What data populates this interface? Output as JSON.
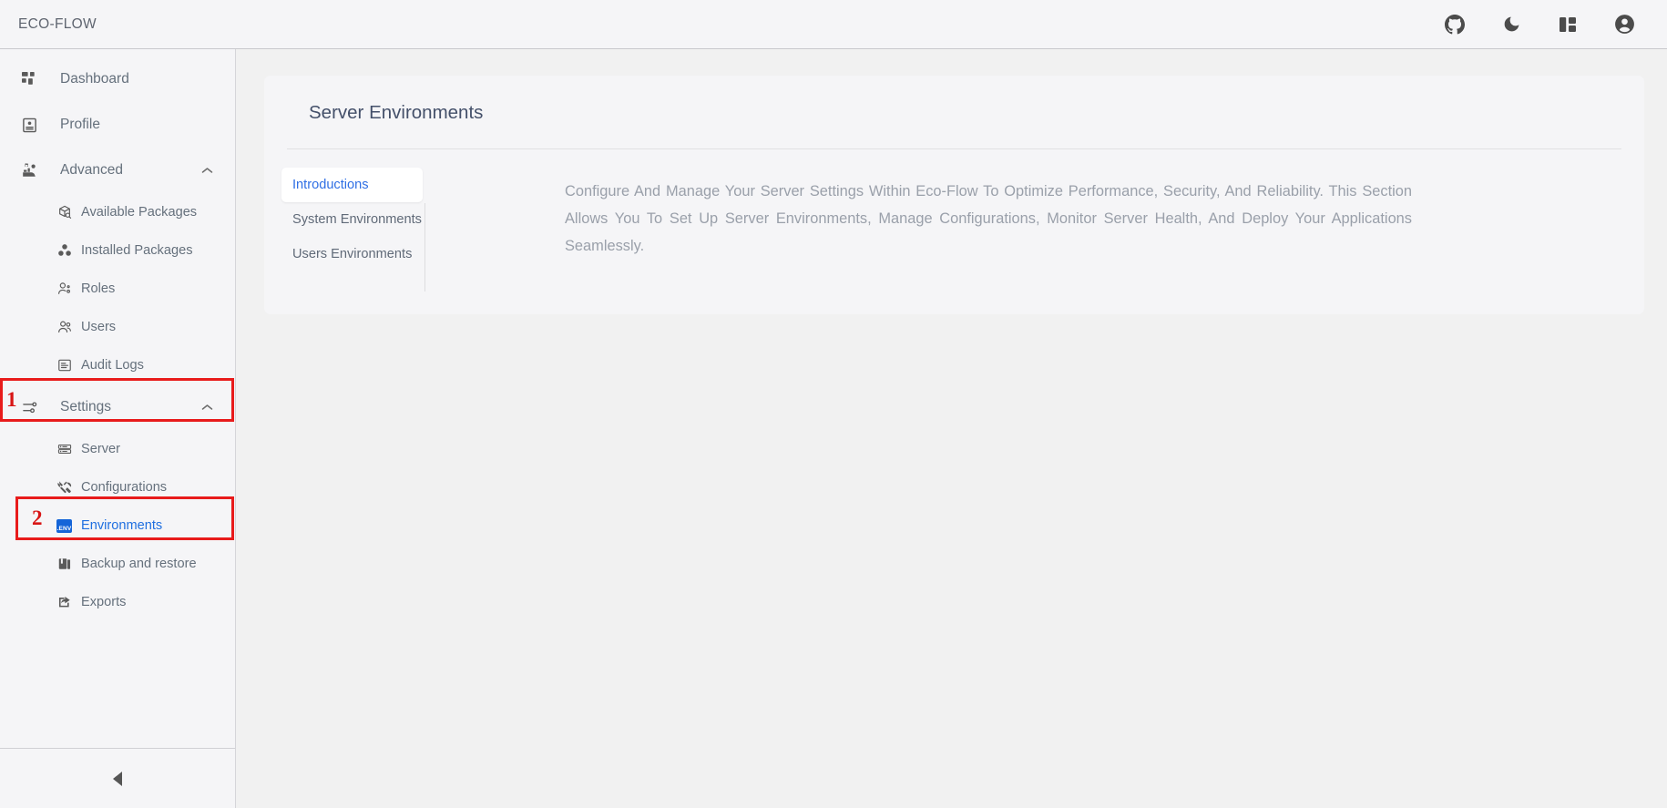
{
  "topbar": {
    "brand": "ECO-FLOW",
    "actions": [
      {
        "name": "github-icon",
        "label": "GitHub"
      },
      {
        "name": "moon-icon",
        "label": "Toggle dark mode"
      },
      {
        "name": "layout-icon",
        "label": "Layout"
      },
      {
        "name": "account-icon",
        "label": "Account"
      }
    ]
  },
  "sidebar": {
    "items": [
      {
        "label": "Dashboard",
        "icon": "dashboard-icon",
        "type": "top"
      },
      {
        "label": "Profile",
        "icon": "profile-icon",
        "type": "top"
      },
      {
        "label": "Advanced",
        "icon": "advanced-icon",
        "type": "group",
        "expanded": true
      },
      {
        "label": "Available Packages",
        "icon": "package-search-icon",
        "type": "sub"
      },
      {
        "label": "Installed Packages",
        "icon": "packages-icon",
        "type": "sub"
      },
      {
        "label": "Roles",
        "icon": "roles-icon",
        "type": "sub"
      },
      {
        "label": "Users",
        "icon": "users-icon",
        "type": "sub"
      },
      {
        "label": "Audit Logs",
        "icon": "audit-logs-icon",
        "type": "sub"
      },
      {
        "label": "Settings",
        "icon": "settings-sliders-icon",
        "type": "group",
        "expanded": true
      },
      {
        "label": "Server",
        "icon": "server-icon",
        "type": "sub"
      },
      {
        "label": "Configurations",
        "icon": "configurations-icon",
        "type": "sub"
      },
      {
        "label": "Environments",
        "icon": "env-badge-icon",
        "type": "sub",
        "active": true
      },
      {
        "label": "Backup and restore",
        "icon": "backup-icon",
        "type": "sub"
      },
      {
        "label": "Exports",
        "icon": "exports-icon",
        "type": "sub"
      }
    ],
    "collapse": {
      "icon": "collapse-left-icon"
    }
  },
  "annotations": [
    {
      "number": "1",
      "target": "Settings"
    },
    {
      "number": "2",
      "target": "Environments"
    }
  ],
  "main": {
    "card": {
      "title": "Server Environments",
      "tabs": [
        {
          "label": "Introductions",
          "active": true
        },
        {
          "label": "System Environments",
          "active": false
        },
        {
          "label": "Users Environments",
          "active": false
        }
      ],
      "body": "Configure And Manage Your Server Settings Within Eco-Flow To Optimize Performance, Security, And Reliability. This Section Allows You To Set Up Server Environments, Manage Configurations, Monitor Server Health, And Deploy Your Applications Seamlessly."
    }
  },
  "colors": {
    "accent": "#2f6fe4",
    "annotation": "#e81b1b",
    "sidebar_bg": "#f5f5f7",
    "main_bg": "#f1f1f1",
    "env_badge": "#1565d8"
  }
}
